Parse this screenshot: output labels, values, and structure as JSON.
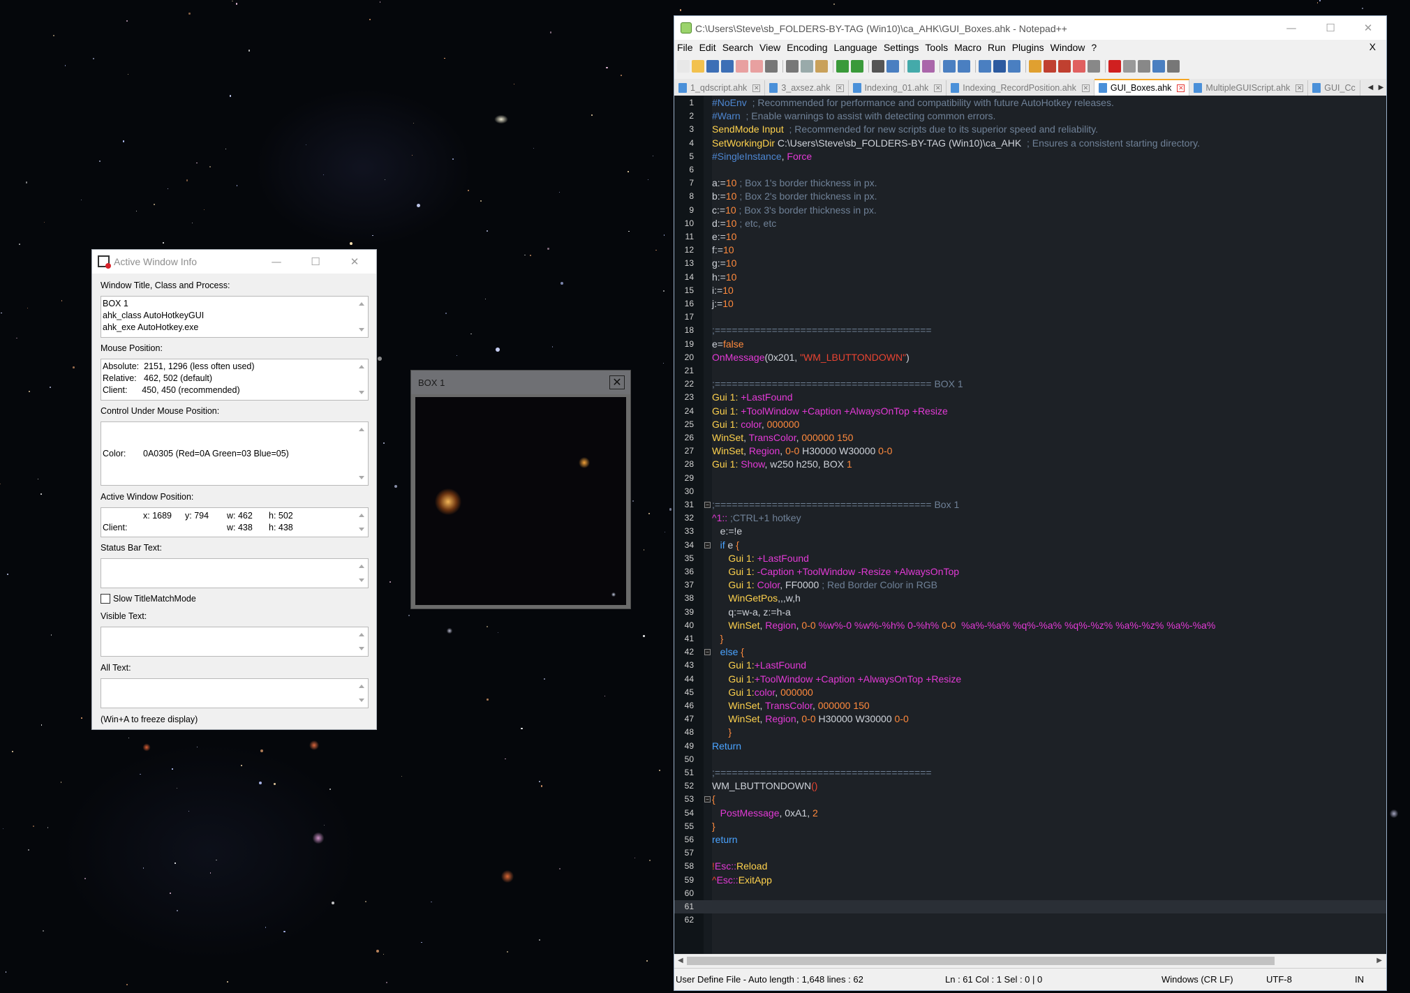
{
  "colors": {
    "editor_bg": "#1d2126",
    "directive": "#4d86d1",
    "comment": "#6f8197",
    "command": "#ffd24d",
    "function": "#e33ad6",
    "string": "#ea4432",
    "number": "#ff8a3d",
    "active_tab_accent": "#f5a623"
  },
  "awi": {
    "title": "Active Window Info",
    "lbl_title": "Window Title, Class and Process:",
    "title_lines": [
      "BOX 1",
      "ahk_class AutoHotkeyGUI",
      "ahk_exe AutoHotkey.exe"
    ],
    "lbl_mouse": "Mouse Position:",
    "mouse_lines": [
      "Absolute:  2151, 1296 (less often used)",
      "Relative:   462, 502 (default)",
      "Client:      450, 450 (recommended)"
    ],
    "lbl_control": "Control Under Mouse Position:",
    "color_label": "Color:",
    "color_value": "0A0305 (Red=0A Green=03 Blue=05)",
    "lbl_active": "Active Window Position:",
    "active_row1": [
      "x: 1689",
      "y: 794",
      "w: 462",
      "h: 502"
    ],
    "active_row2": [
      "Client:",
      "w: 438",
      "h: 438"
    ],
    "lbl_status": "Status Bar Text:",
    "slow_mode": "Slow TitleMatchMode",
    "lbl_visible": "Visible Text:",
    "lbl_all": "All Text:",
    "footer": "(Win+A to freeze display)"
  },
  "box1": {
    "title": "BOX 1",
    "close": "✕"
  },
  "npp": {
    "title": "C:\\Users\\Steve\\sb_FOLDERS-BY-TAG (Win10)\\ca_AHK\\GUI_Boxes.ahk - Notepad++",
    "menu": [
      "File",
      "Edit",
      "Search",
      "View",
      "Encoding",
      "Language",
      "Settings",
      "Tools",
      "Macro",
      "Run",
      "Plugins",
      "Window",
      "?"
    ],
    "menu_close": "X",
    "tabs": [
      {
        "label": "1_qdscript.ahk",
        "active": false
      },
      {
        "label": "3_axsez.ahk",
        "active": false
      },
      {
        "label": "Indexing_01.ahk",
        "active": false
      },
      {
        "label": "Indexing_RecordPosition.ahk",
        "active": false
      },
      {
        "label": "GUI_Boxes.ahk",
        "active": true
      },
      {
        "label": "MultipleGUIScript.ahk",
        "active": false
      },
      {
        "label": "GUI_Cc",
        "active": false
      }
    ],
    "code": [
      [
        [
          "dir",
          "#NoEnv"
        ],
        [
          "cmt",
          "  ; Recommended for performance and compatibility with future AutoHotkey releases."
        ]
      ],
      [
        [
          "dir",
          "#Warn"
        ],
        [
          "cmt",
          "  ; Enable warnings to assist with detecting common errors."
        ]
      ],
      [
        [
          "cmd",
          "SendMode Input"
        ],
        [
          "cmt",
          "  ; Recommended for new scripts due to its superior speed and reliability."
        ]
      ],
      [
        [
          "cmd",
          "SetWorkingDir"
        ],
        [
          "def",
          " C:\\Users\\Steve\\sb_FOLDERS-BY-TAG (Win10)\\ca_AHK"
        ],
        [
          "cmt",
          "  ; Ensures a consistent starting directory."
        ]
      ],
      [
        [
          "dir",
          "#SingleInstance"
        ],
        [
          "def",
          ", "
        ],
        [
          "fn",
          "Force"
        ]
      ],
      [],
      [
        [
          "def",
          "a:="
        ],
        [
          "num",
          "10"
        ],
        [
          "cmt",
          " ; Box 1's border thickness in px."
        ]
      ],
      [
        [
          "def",
          "b:="
        ],
        [
          "num",
          "10"
        ],
        [
          "cmt",
          " ; Box 2's border thickness in px."
        ]
      ],
      [
        [
          "def",
          "c:="
        ],
        [
          "num",
          "10"
        ],
        [
          "cmt",
          " ; Box 3's border thickness in px."
        ]
      ],
      [
        [
          "def",
          "d:="
        ],
        [
          "num",
          "10"
        ],
        [
          "cmt",
          " ; etc, etc"
        ]
      ],
      [
        [
          "def",
          "e:="
        ],
        [
          "num",
          "10"
        ]
      ],
      [
        [
          "def",
          "f:="
        ],
        [
          "num",
          "10"
        ]
      ],
      [
        [
          "def",
          "g:="
        ],
        [
          "num",
          "10"
        ]
      ],
      [
        [
          "def",
          "h:="
        ],
        [
          "num",
          "10"
        ]
      ],
      [
        [
          "def",
          "i:="
        ],
        [
          "num",
          "10"
        ]
      ],
      [
        [
          "def",
          "j:="
        ],
        [
          "num",
          "10"
        ]
      ],
      [],
      [
        [
          "cmt",
          ";======================================"
        ]
      ],
      [
        [
          "def",
          "e="
        ],
        [
          "num",
          "false"
        ]
      ],
      [
        [
          "fn",
          "OnMessage"
        ],
        [
          "def",
          "(0x201, "
        ],
        [
          "str",
          "\"WM_LBUTTONDOWN\""
        ],
        [
          "def",
          ")"
        ]
      ],
      [],
      [
        [
          "cmt",
          ";====================================== BOX 1"
        ]
      ],
      [
        [
          "cmd",
          "Gui 1:"
        ],
        [
          "fn",
          " +LastFound"
        ]
      ],
      [
        [
          "cmd",
          "Gui 1:"
        ],
        [
          "fn",
          " +ToolWindow +Caption +AlwaysOnTop +Resize"
        ]
      ],
      [
        [
          "cmd",
          "Gui 1:"
        ],
        [
          "fn",
          " color"
        ],
        [
          "def",
          ", "
        ],
        [
          "num",
          "000000"
        ]
      ],
      [
        [
          "cmd",
          "WinSet"
        ],
        [
          "def",
          ", "
        ],
        [
          "fn",
          "TransColor"
        ],
        [
          "def",
          ", "
        ],
        [
          "num",
          "000000 150"
        ]
      ],
      [
        [
          "cmd",
          "WinSet"
        ],
        [
          "def",
          ", "
        ],
        [
          "fn",
          "Region"
        ],
        [
          "def",
          ", "
        ],
        [
          "num",
          "0-0"
        ],
        [
          "def",
          " H30000 W30000 "
        ],
        [
          "num",
          "0-0"
        ]
      ],
      [
        [
          "cmd",
          "Gui 1:"
        ],
        [
          "fn",
          " Show"
        ],
        [
          "def",
          ", w250 h250, BOX "
        ],
        [
          "num",
          "1"
        ]
      ],
      [],
      [],
      [
        [
          "cmt",
          ";====================================== Box 1"
        ]
      ],
      [
        [
          "fn",
          "^1::"
        ],
        [
          "cmt",
          " ;CTRL+1 hotkey"
        ]
      ],
      [
        [
          "def",
          "   e:=!e"
        ]
      ],
      [
        [
          "kw",
          "   if"
        ],
        [
          "def",
          " e "
        ],
        [
          "num",
          "{"
        ]
      ],
      [
        [
          "cmd",
          "      Gui 1:"
        ],
        [
          "fn",
          " +LastFound"
        ]
      ],
      [
        [
          "cmd",
          "      Gui 1:"
        ],
        [
          "fn",
          " -Caption +ToolWindow -Resize +AlwaysOnTop"
        ]
      ],
      [
        [
          "cmd",
          "      Gui 1:"
        ],
        [
          "fn",
          " Color"
        ],
        [
          "def",
          ", FF0000 "
        ],
        [
          "cmt",
          "; Red Border Color in RGB"
        ]
      ],
      [
        [
          "cmd",
          "      WinGetPos"
        ],
        [
          "def",
          ",,,w,h"
        ]
      ],
      [
        [
          "def",
          "      q:=w-a, z:=h-a"
        ]
      ],
      [
        [
          "cmd",
          "      WinSet"
        ],
        [
          "def",
          ", "
        ],
        [
          "fn",
          "Region"
        ],
        [
          "def",
          ", "
        ],
        [
          "num",
          "0-0"
        ],
        [
          "fn",
          " %w%-0 %w%-%h% 0-%h% "
        ],
        [
          "num",
          "0-0"
        ],
        [
          "fn",
          "  %a%-%a% %q%-%a% %q%-%z% %a%-%z% %a%-%a%"
        ]
      ],
      [
        [
          "num",
          "   }"
        ]
      ],
      [
        [
          "kw",
          "   else"
        ],
        [
          "num",
          " {"
        ]
      ],
      [
        [
          "cmd",
          "      Gui 1:"
        ],
        [
          "fn",
          "+LastFound"
        ]
      ],
      [
        [
          "cmd",
          "      Gui 1:"
        ],
        [
          "fn",
          "+ToolWindow +Caption +AlwaysOnTop +Resize"
        ]
      ],
      [
        [
          "cmd",
          "      Gui 1:"
        ],
        [
          "fn",
          "color"
        ],
        [
          "def",
          ", "
        ],
        [
          "num",
          "000000"
        ]
      ],
      [
        [
          "cmd",
          "      WinSet"
        ],
        [
          "def",
          ", "
        ],
        [
          "fn",
          "TransColor"
        ],
        [
          "def",
          ", "
        ],
        [
          "num",
          "000000 150"
        ]
      ],
      [
        [
          "cmd",
          "      WinSet"
        ],
        [
          "def",
          ", "
        ],
        [
          "fn",
          "Region"
        ],
        [
          "def",
          ", "
        ],
        [
          "num",
          "0-0"
        ],
        [
          "def",
          " H30000 W30000 "
        ],
        [
          "num",
          "0-0"
        ]
      ],
      [
        [
          "num",
          "      }"
        ]
      ],
      [
        [
          "kw",
          "Return"
        ]
      ],
      [],
      [
        [
          "cmt",
          ";======================================"
        ]
      ],
      [
        [
          "def",
          "WM_LBUTTONDOWN"
        ],
        [
          "str",
          "()"
        ]
      ],
      [
        [
          "num",
          "{"
        ]
      ],
      [
        [
          "fn",
          "   PostMessage"
        ],
        [
          "def",
          ", 0xA1, "
        ],
        [
          "num",
          "2"
        ]
      ],
      [
        [
          "num",
          "}"
        ]
      ],
      [
        [
          "kw",
          "return"
        ]
      ],
      [],
      [
        [
          "str",
          "!"
        ],
        [
          "fn",
          "Esc::"
        ],
        [
          "cmd",
          "Reload"
        ]
      ],
      [
        [
          "str",
          "^"
        ],
        [
          "fn",
          "Esc::"
        ],
        [
          "cmd",
          "ExitApp"
        ]
      ],
      [],
      [],
      []
    ],
    "fold_lines": [
      31,
      34,
      42,
      53
    ],
    "current_line": 61,
    "status": {
      "type": "User Define File - Auto length : 1,648    lines : 62",
      "pos": "Ln : 61    Col : 1    Sel : 0 | 0",
      "eol": "Windows (CR LF)",
      "enc": "UTF-8",
      "ins": "IN"
    }
  }
}
